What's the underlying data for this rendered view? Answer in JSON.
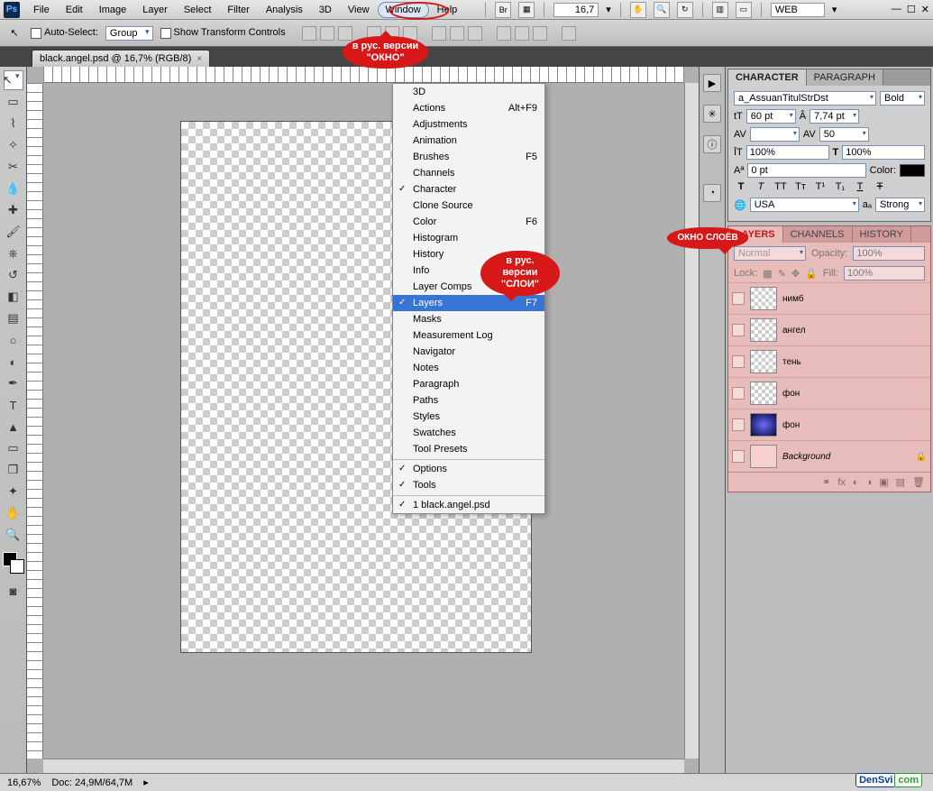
{
  "menu": {
    "items": [
      "File",
      "Edit",
      "Image",
      "Layer",
      "Select",
      "Filter",
      "Analysis",
      "3D",
      "View",
      "Window",
      "Help"
    ],
    "active": "Window",
    "zoom": "16,7",
    "preset": "WEB"
  },
  "options": {
    "autoSelect": "Auto-Select:",
    "group": "Group",
    "showTransform": "Show Transform Controls"
  },
  "docTab": "black.angel.psd @ 16,7% (RGB/8)",
  "dropdown": [
    {
      "l": "3D"
    },
    {
      "l": "Actions",
      "s": "Alt+F9"
    },
    {
      "l": "Adjustments"
    },
    {
      "l": "Animation"
    },
    {
      "l": "Brushes",
      "s": "F5"
    },
    {
      "l": "Channels"
    },
    {
      "l": "Character",
      "c": true
    },
    {
      "l": "Clone Source"
    },
    {
      "l": "Color",
      "s": "F6"
    },
    {
      "l": "Histogram"
    },
    {
      "l": "History"
    },
    {
      "l": "Info"
    },
    {
      "l": "Layer Comps"
    },
    {
      "l": "Layers",
      "s": "F7",
      "c": true,
      "hl": true
    },
    {
      "l": "Masks"
    },
    {
      "l": "Measurement Log"
    },
    {
      "l": "Navigator"
    },
    {
      "l": "Notes"
    },
    {
      "l": "Paragraph"
    },
    {
      "l": "Paths"
    },
    {
      "l": "Styles"
    },
    {
      "l": "Swatches"
    },
    {
      "l": "Tool Presets"
    },
    {
      "l": "Options",
      "c": true,
      "sep": true
    },
    {
      "l": "Tools",
      "c": true
    },
    {
      "l": "1 black.angel.psd",
      "c": true,
      "sep": true
    }
  ],
  "charPanel": {
    "tabs": [
      "CHARACTER",
      "PARAGRAPH"
    ],
    "font": "a_AssuanTitulStrDst",
    "weight": "Bold",
    "size": "60 pt",
    "leading": "7,74 pt",
    "tracking": "50",
    "hscale": "100%",
    "vscale": "100%",
    "baseline": "0 pt",
    "colorLabel": "Color:",
    "lang": "USA",
    "aa": "Strong",
    "aaLabel": "aₐ"
  },
  "layersPanel": {
    "tabs": [
      "LAYERS",
      "CHANNELS",
      "HISTORY"
    ],
    "blend": "Normal",
    "opacityL": "Opacity:",
    "opacity": "100%",
    "lockL": "Lock:",
    "fillL": "Fill:",
    "fill": "100%",
    "layers": [
      {
        "name": "нимб"
      },
      {
        "name": "ангел"
      },
      {
        "name": "тень"
      },
      {
        "name": "фон"
      },
      {
        "name": "фон",
        "dark": true
      },
      {
        "name": "Background",
        "locked": true,
        "italic": true,
        "solid": "#f7cfcf"
      }
    ]
  },
  "status": {
    "zoom": "16,67%",
    "doc": "Doc: 24,9M/64,7M"
  },
  "annot": {
    "b1a": "в рус. версии",
    "b1b": "\"ОКНО\"",
    "b2a": "в рус. версии",
    "b2b": "\"СЛОИ\"",
    "b3": "ОКНО СЛОЁВ"
  },
  "watermark": {
    "a": "DenSvi",
    "b": "com"
  }
}
